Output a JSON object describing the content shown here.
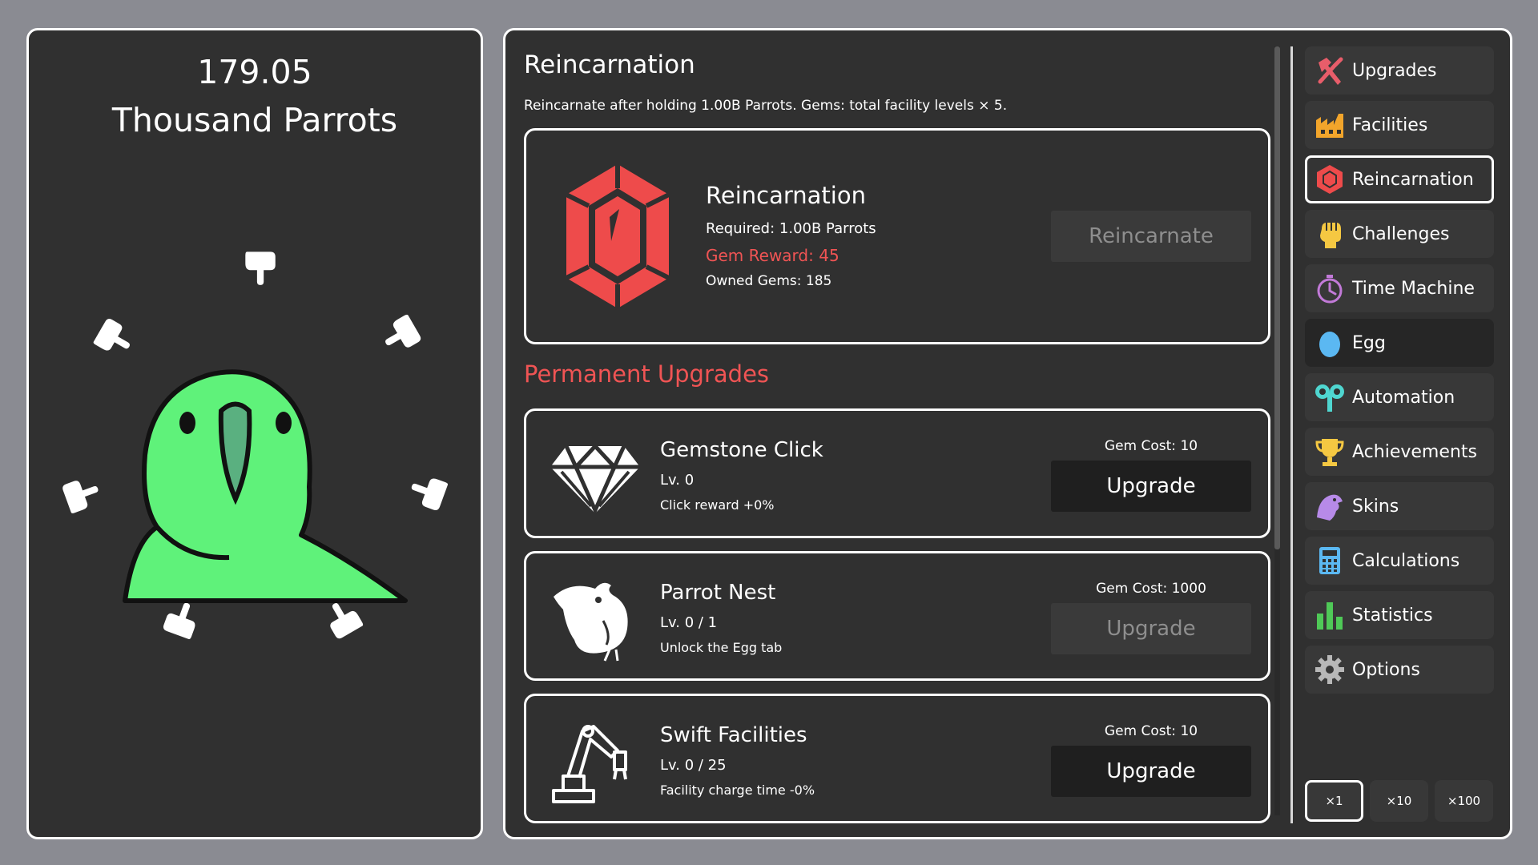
{
  "counter": {
    "value": "179.05",
    "unit": "Thousand Parrots"
  },
  "section": {
    "title": "Reincarnation",
    "description": "Reincarnate after holding 1.00B Parrots. Gems: total facility levels × 5."
  },
  "reincarnation_card": {
    "title": "Reincarnation",
    "required": "Required: 1.00B Parrots",
    "gem_reward": "Gem Reward: 45",
    "owned_gems": "Owned Gems: 185",
    "button_label": "Reincarnate",
    "icon": "red-gem-icon"
  },
  "permanent_title": "Permanent Upgrades",
  "upgrades": [
    {
      "name": "Gemstone Click",
      "level": "Lv. 0",
      "desc": "Click reward +0%",
      "cost": "Gem Cost: 10",
      "button_label": "Upgrade",
      "enabled": true,
      "icon": "diamond-icon"
    },
    {
      "name": "Parrot Nest",
      "level": "Lv. 0 / 1",
      "desc": "Unlock the Egg tab",
      "cost": "Gem Cost: 1000",
      "button_label": "Upgrade",
      "enabled": false,
      "icon": "bird-icon"
    },
    {
      "name": "Swift Facilities",
      "level": "Lv. 0 / 25",
      "desc": "Facility charge time -0%",
      "cost": "Gem Cost: 10",
      "button_label": "Upgrade",
      "enabled": true,
      "icon": "robot-arm-icon"
    }
  ],
  "nav": [
    {
      "label": "Upgrades",
      "icon": "hammer-icon"
    },
    {
      "label": "Facilities",
      "icon": "factory-icon"
    },
    {
      "label": "Reincarnation",
      "icon": "gem-icon",
      "active": true
    },
    {
      "label": "Challenges",
      "icon": "fist-icon"
    },
    {
      "label": "Time Machine",
      "icon": "stopwatch-icon"
    },
    {
      "label": "Egg",
      "icon": "egg-icon"
    },
    {
      "label": "Automation",
      "icon": "wind-up-key-icon"
    },
    {
      "label": "Achievements",
      "icon": "trophy-icon"
    },
    {
      "label": "Skins",
      "icon": "bird-head-icon"
    },
    {
      "label": "Calculations",
      "icon": "calculator-icon"
    },
    {
      "label": "Statistics",
      "icon": "bar-chart-icon"
    },
    {
      "label": "Options",
      "icon": "gear-icon"
    }
  ],
  "multipliers": [
    {
      "label": "×1",
      "active": true
    },
    {
      "label": "×10"
    },
    {
      "label": "×100"
    }
  ],
  "colors": {
    "accent_red": "#f05454",
    "parrot_green": "#5ff27a",
    "panel_bg": "#303030",
    "page_bg": "#8a8b92"
  }
}
